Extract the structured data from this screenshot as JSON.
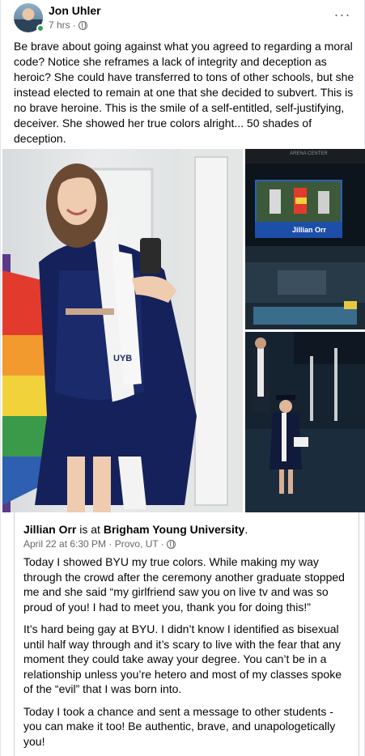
{
  "post": {
    "author": "Jon Uhler",
    "time": "7 hrs ·",
    "privacy_icon": "globe-icon",
    "more_label": "···",
    "text": "Be brave about going against what you agreed to regarding a moral code?  Notice she reframes a lack of integrity and deception as heroic? She could have transferred to tons of other schools, but she instead elected to remain at one that she decided to subvert. This is no brave heroine. This is the smile of a self-entitled, self-justifying, deceiver. She showed her true colors alright... 50 shades of deception."
  },
  "photos": {
    "stole_text": "UYB",
    "screen_caption": "Jillian Orr",
    "arena_banner": "ARENA CENTER"
  },
  "shared": {
    "author": "Jillian Orr",
    "is_at": " is at ",
    "place": "Brigham Young University",
    "period": ".",
    "meta": "April 22 at 6:30 PM · Provo, UT ·",
    "paragraphs": [
      "Today I showed BYU my true colors. While making my way through the crowd after the ceremony another graduate stopped me and she said “my girlfriend saw you on live tv and was so proud of you! I had to meet you, thank you for doing this!”",
      "It’s hard being gay at BYU. I didn’t know I identified as bisexual until half way through and it’s scary to live with the fear that any moment they could take away your degree. You can’t be in a relationship unless you’re hetero and most of my classes spoke of the “evil” that I was born into.",
      "Today I took a chance and sent a message to other students - you can make it too! Be authentic, brave, and unapologetically you!"
    ]
  },
  "colors": {
    "text_primary": "#050505",
    "text_secondary": "#65676b",
    "online": "#31a24c"
  }
}
